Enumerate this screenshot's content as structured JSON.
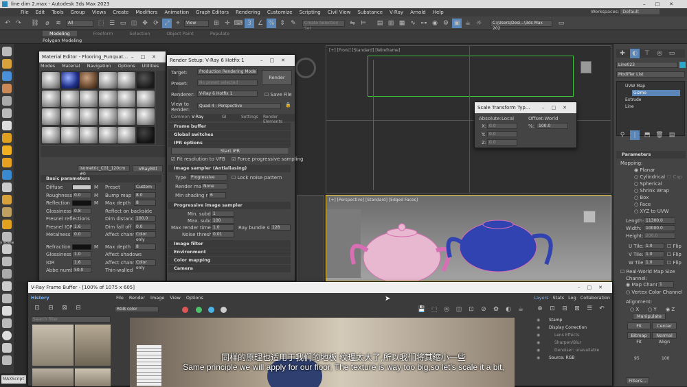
{
  "app": {
    "title": "line dim 2.max - Autodesk 3ds Max 2023",
    "workspace_label": "Workspaces:",
    "workspace_value": "Default"
  },
  "menubar": [
    "File",
    "Edit",
    "Tools",
    "Group",
    "Views",
    "Create",
    "Modifiers",
    "Animation",
    "Graph Editors",
    "Rendering",
    "Customize",
    "Scripting",
    "Civil View",
    "Substance",
    "V-Ray",
    "Arnold",
    "Help"
  ],
  "toolbar": {
    "filter": "All",
    "view": "View",
    "selection_set": "Create Selection Set",
    "path": "C:\\Users\\Desi...\\3ds Max 202"
  },
  "ribbon_tabs": [
    "Modeling",
    "Freeform",
    "Selection",
    "Object Paint",
    "Populate"
  ],
  "ribbon_sub": "Polygon Modeling",
  "material_editor": {
    "title": "Material Editor - Flooring_Funquat...",
    "menu": [
      "Modes",
      "Material",
      "Navigation",
      "Options",
      "Utilities"
    ],
    "material_name": "isometric_C01_120cm #0",
    "material_type": "VRayMtl",
    "section": "Basic parameters",
    "params": [
      {
        "label": "Diffuse",
        "extra": "M",
        "right_label": "Preset",
        "right_value": "Custom"
      },
      {
        "label": "Roughness",
        "value": "0.0",
        "extra": "M",
        "right_label": "Bump map",
        "right_value": "8.0"
      },
      {
        "label": "Reflection",
        "extra": "M",
        "right_label": "Max depth",
        "right_value": "8"
      },
      {
        "label": "Glossiness",
        "value": "0.8",
        "right_label": "Reflect on backside"
      },
      {
        "label": "Fresnel reflections",
        "right_label": "Dim distance",
        "right_value": "100.0"
      },
      {
        "label": "Fresnel IOR",
        "value": "1.6",
        "right_label": "Dim fall off",
        "right_value": "0.0"
      },
      {
        "label": "Metalness",
        "value": "0.0",
        "right_label": "Affect channels",
        "right_value": "Color only"
      },
      {
        "label": "Refraction",
        "extra": "M",
        "right_label": "Max depth",
        "right_value": "8"
      },
      {
        "label": "Glossiness",
        "value": "1.0",
        "right_label": "Affect shadows"
      },
      {
        "label": "IOR",
        "value": "1.6",
        "right_label": "Affect channels",
        "right_value": "Color only"
      },
      {
        "label": "Abbe number",
        "value": "50.0",
        "right_label": "Thin-walled"
      }
    ]
  },
  "render_setup": {
    "title": "Render Setup: V-Ray 6 Hotfix 1",
    "target_label": "Target:",
    "target": "Production Rendering Mode",
    "preset_label": "Preset:",
    "preset": "No preset selected",
    "renderer_label": "Renderer:",
    "renderer": "V-Ray 6 Hotfix 1",
    "save_file": "Save File",
    "view_label": "View to Render:",
    "view": "Quad 4 - Perspective",
    "render_btn": "Render",
    "tabs": [
      "Common",
      "V-Ray",
      "GI",
      "Settings",
      "Render Elements"
    ],
    "frame_buffer": "Frame buffer",
    "global_switches": "Global switches",
    "ipr": "IPR options",
    "start_ipr": "Start IPR",
    "fit_vfb": "Fit resolution to VFB",
    "force_prog": "Force progressive sampling",
    "sampler": "Image sampler (Antialiasing)",
    "type_label": "Type",
    "type": "Progressive",
    "lock_noise": "Lock noise pattern",
    "render_mask_label": "Render mask",
    "render_mask": "None",
    "shading_label": "Min shading rate",
    "shading": "6",
    "prog_sampler": "Progressive image sampler",
    "min_subdivs_label": "Min. subdivs",
    "min_subdivs": "1",
    "max_subdivs_label": "Max. subdivs",
    "max_subdivs": "100",
    "max_time_label": "Max render time (min):",
    "max_time": "1.0",
    "bundle_label": "Ray bundle size:",
    "bundle": "128",
    "noise_label": "Noise threshold:",
    "noise": "0.01",
    "more": [
      "Image filter",
      "Environment",
      "Color mapping",
      "Camera"
    ]
  },
  "scale_transform": {
    "title": "Scale Transform Typ...",
    "absolute": "Absolute:Local",
    "offset": "Offset:World",
    "x": "0.0",
    "y": "0.0",
    "z": "0.0",
    "pct_label": "%:",
    "pct": "100.0",
    "x_label": "X:",
    "y_label": "Y:",
    "z_label": "Z:"
  },
  "viewports": {
    "front": "[+] [Front] [Standard] [Wireframe]",
    "persp": "[+] [Perspective] [Standard] [Edged Faces]"
  },
  "modifier": {
    "name": "Line023",
    "list": "Modifier List",
    "stack": [
      "UVW Map",
      "Gizmo",
      "Extrude",
      "Line"
    ],
    "params_title": "Parameters",
    "mapping_label": "Mapping:",
    "mapping": [
      "Planar",
      "Cylindrical",
      "Spherical",
      "Shrink Wrap",
      "Box",
      "Face",
      "XYZ to UVW"
    ],
    "cap": "Cap",
    "length_label": "Length:",
    "length": "11300.0",
    "width_label": "Width:",
    "width": "10000.0",
    "height_label": "Height:",
    "height": "200.0",
    "utile_label": "U Tile:",
    "utile": "1.0",
    "vtile_label": "V Tile:",
    "vtile": "1.0",
    "wtile_label": "W Tile:",
    "wtile": "1.0",
    "flip": "Flip",
    "realworld": "Real-World Map Size",
    "channel_label": "Channel:",
    "map_channel": "Map Channel:",
    "map_channel_val": "1",
    "vertex_color": "Vertex Color Channel",
    "alignment": "Alignment:",
    "axes": [
      "X",
      "Y",
      "Z"
    ],
    "manipulate": "Manipulate",
    "fit": "Fit",
    "center": "Center",
    "bitmap_fit": "Bitmap Fit",
    "normal_align": "Normal Align",
    "filters": "Filters...",
    "num_a": "95",
    "num_b": "100"
  },
  "vfb": {
    "title": "V-Ray Frame Buffer - [100% of 1075 x 605]",
    "menu": [
      "File",
      "Render",
      "Image",
      "View",
      "Options"
    ],
    "history": "History",
    "search": "Search filter",
    "channel": "RGB color",
    "layer_tabs": [
      "Layers",
      "Stats",
      "Log",
      "Collaboration"
    ],
    "layers": [
      "Stamp",
      "Display Correction",
      "Lens Effects",
      "Sharpen/Blur",
      "Denoiser: unavailable",
      "Source: RGB"
    ]
  },
  "left_labels": {
    "scene_conv": "y scene conve",
    "maxscript": "MAXScript"
  },
  "subtitle": {
    "zh": "同样的原理也适用于我们的地板 纹理太大了,所以我们将其缩小一些",
    "en": "Same principle we will apply for our floor, The texture is way too big,so let's scale it a bit,"
  },
  "colors": {
    "accent": "#4a90d9",
    "selected": "#5b86b8",
    "teapot_mesh": "#d86fb4",
    "teapot_blue": "#3043b0",
    "wire_green": "#3cc43c"
  }
}
